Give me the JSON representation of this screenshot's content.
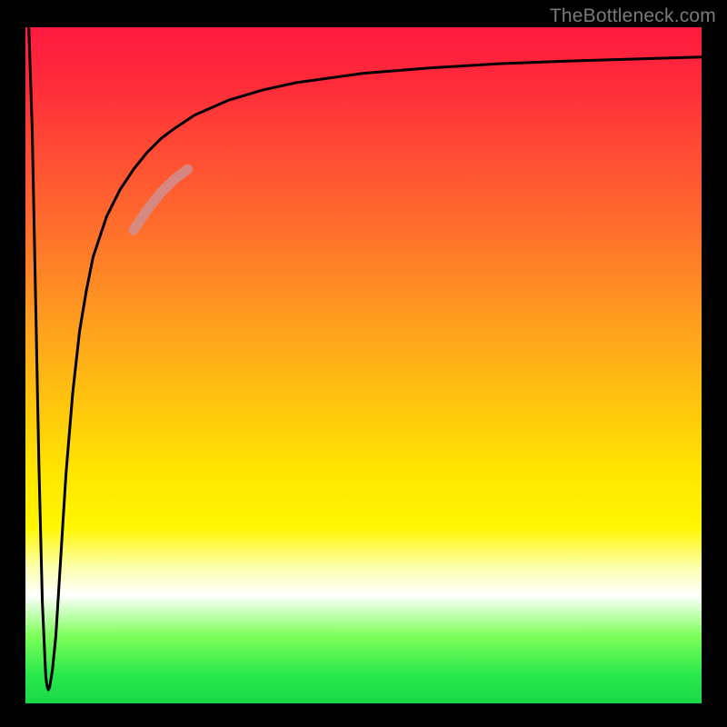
{
  "attribution": "TheBottleneck.com",
  "chart_data": {
    "type": "line",
    "title": "",
    "xlabel": "",
    "ylabel": "",
    "xlim": [
      0,
      100
    ],
    "ylim": [
      0,
      100
    ],
    "grid": false,
    "legend": false,
    "gradient_stops": [
      {
        "pos": 0,
        "color": "#ff1a3f"
      },
      {
        "pos": 8,
        "color": "#ff2a3a"
      },
      {
        "pos": 18,
        "color": "#ff4a34"
      },
      {
        "pos": 30,
        "color": "#ff6f2c"
      },
      {
        "pos": 42,
        "color": "#ff9820"
      },
      {
        "pos": 54,
        "color": "#ffc010"
      },
      {
        "pos": 66,
        "color": "#ffe600"
      },
      {
        "pos": 74,
        "color": "#fff700"
      },
      {
        "pos": 80,
        "color": "#fcffb0"
      },
      {
        "pos": 84,
        "color": "#ffffff"
      },
      {
        "pos": 90,
        "color": "#7dff5a"
      },
      {
        "pos": 96,
        "color": "#27e84a"
      },
      {
        "pos": 100,
        "color": "#18d848"
      }
    ],
    "series": [
      {
        "name": "curve",
        "color": "#000000",
        "stroke_width": 3,
        "x": [
          0.5,
          1.0,
          1.5,
          2.0,
          2.5,
          3.0,
          3.2,
          3.4,
          3.6,
          4.0,
          4.5,
          5.0,
          5.5,
          6.0,
          7.0,
          8.0,
          9.0,
          10.0,
          12.0,
          14.0,
          16.0,
          18.0,
          20.0,
          22.0,
          25.0,
          30.0,
          35.0,
          40.0,
          50.0,
          60.0,
          70.0,
          80.0,
          90.0,
          100.0
        ],
        "y": [
          100.0,
          85.0,
          60.0,
          35.0,
          15.0,
          4.0,
          2.5,
          2.0,
          2.5,
          5.0,
          10.0,
          18.0,
          26.0,
          34.0,
          46.0,
          55.0,
          61.0,
          66.0,
          72.0,
          76.0,
          79.0,
          81.5,
          83.5,
          85.0,
          87.0,
          89.2,
          90.7,
          91.8,
          93.2,
          94.0,
          94.6,
          95.0,
          95.3,
          95.6
        ]
      },
      {
        "name": "highlight-segment",
        "color": "#cf8f8f",
        "stroke_width": 11,
        "opacity": 0.85,
        "x": [
          16.0,
          18.0,
          20.0,
          22.0,
          24.0
        ],
        "y": [
          70.0,
          73.0,
          75.5,
          77.5,
          79.0
        ]
      }
    ]
  }
}
